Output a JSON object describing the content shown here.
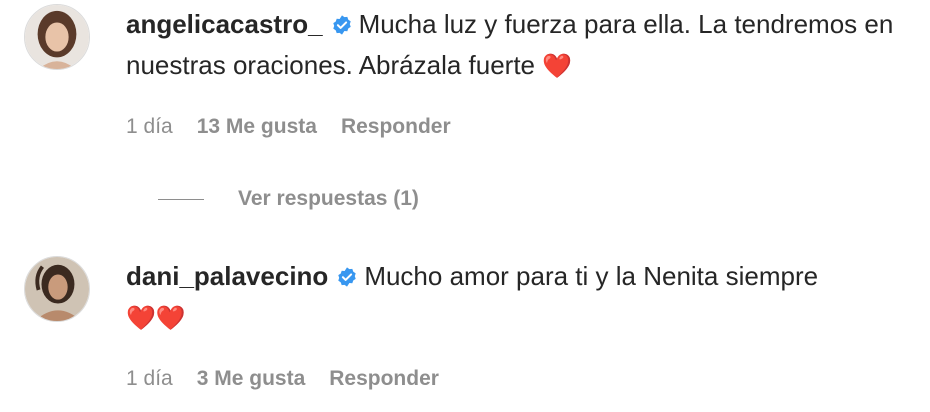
{
  "comments": [
    {
      "username": "angelicacastro_",
      "verified": true,
      "text": "Mucha luz y fuerza para ella. La tendremos en nuestras oraciones. Abrázala fuerte",
      "emoji": "❤️",
      "time": "1 día",
      "likes": "13 Me gusta",
      "reply": "Responder",
      "view_replies": "Ver respuestas (1)"
    },
    {
      "username": "dani_palavecino",
      "verified": true,
      "text": "Mucho amor para ti y la Nenita siempre",
      "emoji": "❤️❤️",
      "time": "1 día",
      "likes": "3 Me gusta",
      "reply": "Responder"
    }
  ],
  "colors": {
    "text": "#262626",
    "muted": "#8e8e8e",
    "verified": "#3897f0",
    "heart": "#ed2939"
  }
}
